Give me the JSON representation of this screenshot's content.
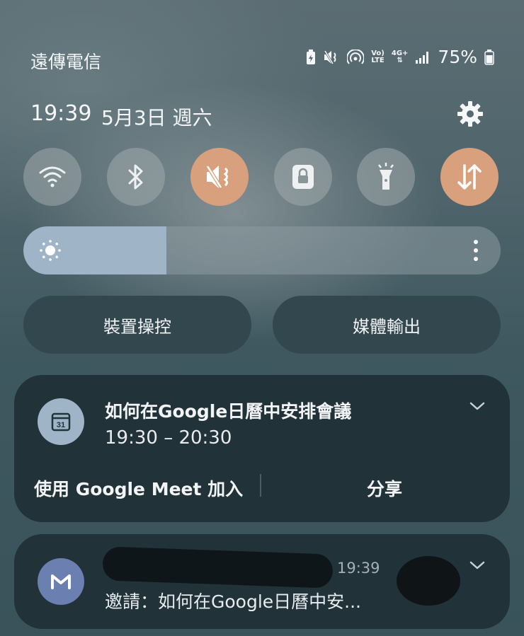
{
  "status_bar": {
    "carrier": "遠傳電信",
    "network_tag_top": "Vo)",
    "network_tag_bottom": "LTE",
    "data_tag": "4G+",
    "battery": "75%",
    "icons": [
      "data-saver-icon",
      "mute-icon",
      "hotspot-icon",
      "volte-icon",
      "data-4g-icon",
      "signal-icon",
      "battery-icon"
    ]
  },
  "header": {
    "time": "19:39",
    "date": "5月3日 週六",
    "settings_icon": "gear-icon"
  },
  "quick_toggles": [
    {
      "name": "wifi",
      "icon": "wifi-icon",
      "active": false
    },
    {
      "name": "bluetooth",
      "icon": "bluetooth-icon",
      "active": false
    },
    {
      "name": "sound",
      "icon": "mute-icon",
      "active": true
    },
    {
      "name": "rotation-lock",
      "icon": "lock-icon",
      "active": false
    },
    {
      "name": "flashlight",
      "icon": "flashlight-icon",
      "active": false
    },
    {
      "name": "mobile-data",
      "icon": "data-transfer-icon",
      "active": true
    }
  ],
  "colors": {
    "active_toggle": "#d9a07e",
    "inactive_toggle": "#a0aaac",
    "brightness_fill": "#9fb4c6",
    "card_bg": "#213238",
    "calendar_avatar": "#9fb4c6",
    "gmail_avatar": "#6b7fb0"
  },
  "brightness": {
    "level": 0.3,
    "icon": "sun-icon",
    "menu_icon": "more-vertical-icon"
  },
  "buttons": {
    "device_control": "裝置操控",
    "media_output": "媒體輸出"
  },
  "notifications": [
    {
      "app_icon": "calendar-icon",
      "avatar_text": "31",
      "title": "如何在Google日曆中安排會議",
      "subtitle": "19:30 – 20:30",
      "actions": [
        "使用 Google Meet 加入",
        "分享"
      ]
    },
    {
      "app_icon": "gmail-icon",
      "sender": "",
      "time": "19:39",
      "body": "邀請：如何在Google日曆中安..."
    }
  ]
}
